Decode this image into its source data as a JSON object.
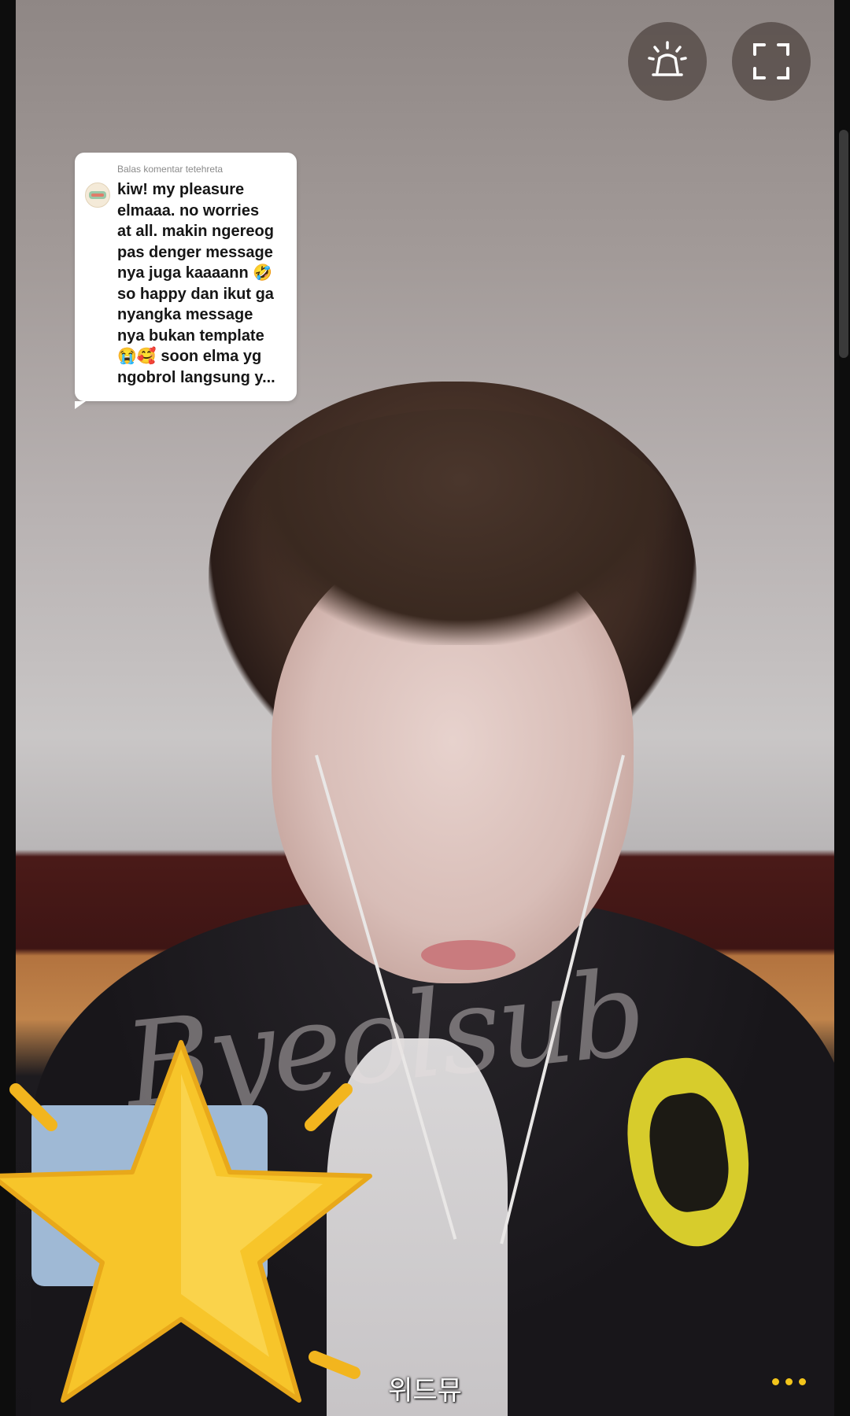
{
  "reply_card": {
    "header": "Balas komentar tetehreta",
    "lines": [
      "kiw! my pleasure",
      "elmaaa. no worries",
      "at all. makin ngereog",
      "pas denger message",
      "nya juga kaaaann 🤣",
      "so happy dan ikut ga",
      "nyangka message",
      "nya bukan template",
      "😭🥰 soon elma yg",
      "ngobrol langsung y..."
    ]
  },
  "watermark": "Byeolsub",
  "caption": "위드뮤",
  "controls": {
    "alert_icon": "siren-icon",
    "fullscreen_icon": "fullscreen-icon",
    "more_icon": "more-dots-icon"
  },
  "colors": {
    "accent_star": "#f7c52a",
    "more_dots": "#f2c41b"
  }
}
